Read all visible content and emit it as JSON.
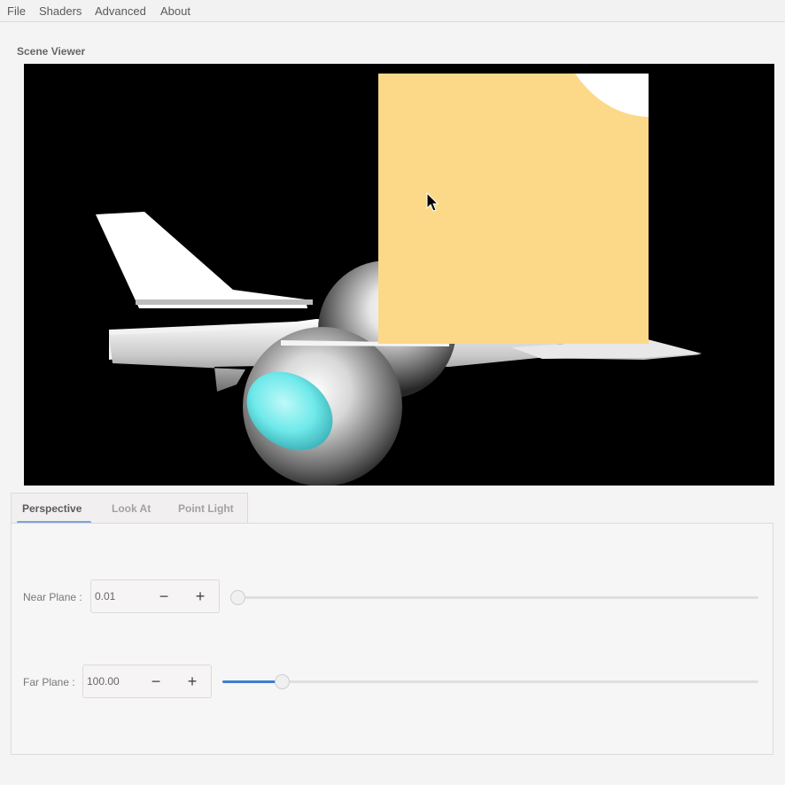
{
  "menu": {
    "items": [
      "File",
      "Shaders",
      "Advanced",
      "About"
    ]
  },
  "viewer": {
    "title": "Scene Viewer"
  },
  "tabs": {
    "items": [
      "Perspective",
      "Look At",
      "Point Light"
    ],
    "active": "Perspective"
  },
  "perspective": {
    "near_plane": {
      "label": "Near Plane :",
      "value": "0.01",
      "decrement": "−",
      "increment": "+",
      "slider_fraction": 0.0
    },
    "far_plane": {
      "label": "Far Plane :",
      "value": "100.00",
      "decrement": "−",
      "increment": "+",
      "slider_fraction": 0.11
    }
  },
  "colors": {
    "accent": "#3d7dd6",
    "viewer_background": "#000000",
    "overlay_quad": "#fcd988",
    "cockpit": "#6fe9ea"
  }
}
